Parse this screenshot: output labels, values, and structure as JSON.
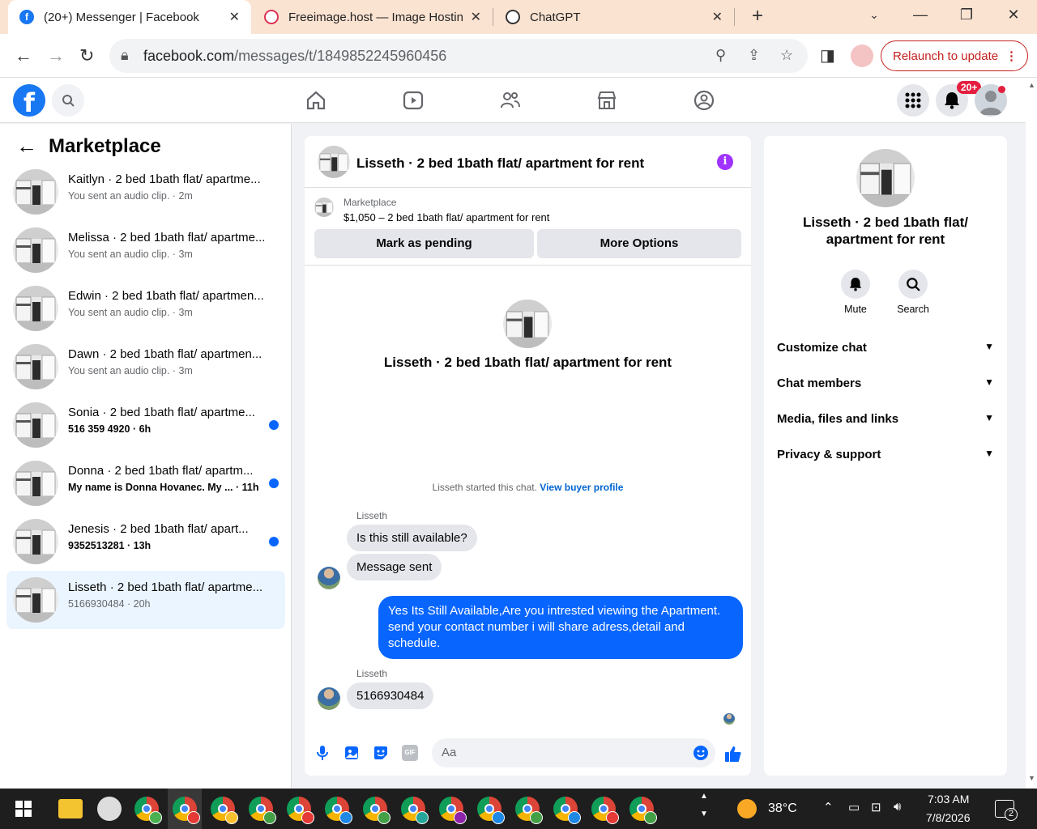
{
  "browser": {
    "tabs": [
      {
        "title": "(20+) Messenger | Facebook",
        "icon": "facebook-icon"
      },
      {
        "title": "Freeimage.host — Image Hosting",
        "icon": "freeimage-icon"
      },
      {
        "title": "ChatGPT",
        "icon": "chatgpt-icon"
      }
    ],
    "url_host": "facebook.com",
    "url_path": "/messages/t/1849852245960456",
    "relaunch_label": "Relaunch to update"
  },
  "fbnav": {
    "notif_badge": "20+"
  },
  "sidebar": {
    "title": "Marketplace",
    "conversations": [
      {
        "name": "Kaitlyn · 2 bed 1bath flat/ apartme...",
        "sub": "You sent an audio clip. · 2m",
        "unread": false
      },
      {
        "name": "Melissa · 2 bed 1bath flat/ apartme...",
        "sub": "You sent an audio clip. · 3m",
        "unread": false
      },
      {
        "name": "Edwin · 2 bed 1bath flat/ apartmen...",
        "sub": "You sent an audio clip. · 3m",
        "unread": false
      },
      {
        "name": "Dawn · 2 bed 1bath flat/ apartmen...",
        "sub": "You sent an audio clip. · 3m",
        "unread": false
      },
      {
        "name": "Sonia · 2 bed 1bath flat/ apartme...",
        "sub": "516 359 4920 · 6h",
        "unread": true
      },
      {
        "name": "Donna · 2 bed 1bath flat/ apartm...",
        "sub": "My name is Donna Hovanec. My ... · 11h",
        "unread": true
      },
      {
        "name": "Jenesis · 2 bed 1bath flat/ apart...",
        "sub": "9352513281 · 13h",
        "unread": true
      },
      {
        "name": "Lisseth · 2 bed 1bath flat/ apartme...",
        "sub": "5166930484 · 20h",
        "unread": false
      }
    ]
  },
  "chat": {
    "title": "Lisseth · 2 bed 1bath flat/ apartment for rent",
    "marketplace_label": "Marketplace",
    "listing": "$1,050 – 2 bed 1bath flat/ apartment for rent",
    "mark_pending": "Mark as pending",
    "more_options": "More Options",
    "center_title": "Lisseth · 2 bed 1bath flat/ apartment for rent",
    "started_text": "Lisseth started this chat.",
    "view_buyer": "View buyer profile",
    "sender_name": "Lisseth",
    "msg1": "Is this still available?",
    "msg2": "Message sent",
    "reply": "Yes Its Still Available,Are you intrested viewing the Apartment. send your contact number i will share adress,detail and schedule.",
    "msg3": "5166930484",
    "composer_placeholder": "Aa"
  },
  "info": {
    "title": "Lisseth · 2 bed 1bath flat/ apartment for rent",
    "mute": "Mute",
    "search": "Search",
    "options": [
      "Customize chat",
      "Chat members",
      "Media, files and links",
      "Privacy & support"
    ]
  },
  "taskbar": {
    "temperature": "38°C",
    "time": "7:03 AM",
    "date": "7/8/2026",
    "notif_count": "2"
  },
  "colors": {
    "fb_blue": "#1877f2",
    "messenger_blue": "#0866ff",
    "info_purple": "#a033ff"
  }
}
